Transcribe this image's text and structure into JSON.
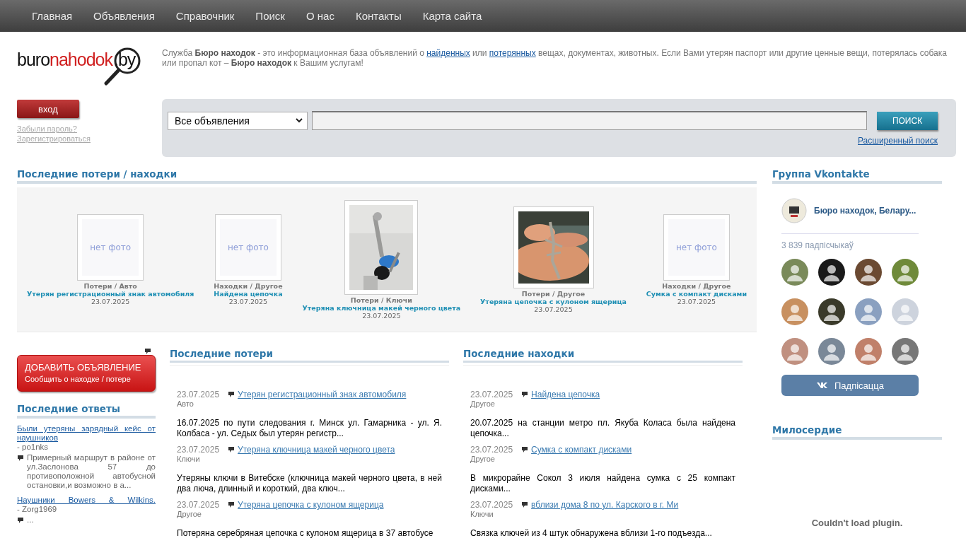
{
  "nav": [
    {
      "label": "Главная"
    },
    {
      "label": "Объявления"
    },
    {
      "label": "Справочник"
    },
    {
      "label": "Поиск"
    },
    {
      "label": "О нас"
    },
    {
      "label": "Контакты"
    },
    {
      "label": "Карта сайта"
    }
  ],
  "logo": {
    "part1": "buro",
    "part2": "nahodok",
    "part3": ".by"
  },
  "intro": [
    {
      "kind": "text",
      "text": "Служба **Бюро находок** - это информационная база объявлений о "
    },
    {
      "kind": "link",
      "text": "найденных"
    },
    {
      "kind": "text",
      "text": " или "
    },
    {
      "kind": "link",
      "text": "потерянных"
    },
    {
      "kind": "text",
      "text": " вещах, документах, животных. Если Вами утерян паспорт или другие ценные вещи, потерялась собака или пропал кот – **Бюро находок** к Вашим услугам!"
    }
  ],
  "login": {
    "button": "вход",
    "forgot": "Забыли пароль?",
    "register": "Зарегистрироваться"
  },
  "search": {
    "category": "Все объявления",
    "button": "ПОИСК",
    "advanced": "Расширенный поиск"
  },
  "gallery": {
    "title": "Последние потери / находки",
    "items": [
      {
        "no_photo_label": "нет фото",
        "category": "Потери / Авто",
        "title": "Утерян регистрационный знак автомобиля",
        "date": "23.07.2025"
      },
      {
        "no_photo_label": "нет фото",
        "category": "Находки / Другое",
        "title": "Найдена цепочка",
        "date": "23.07.2025"
      },
      {
        "kind": "picture",
        "category": "Потери / Ключи",
        "title": "Утеряна ключница макей черного цвета",
        "date": "23.07.2025"
      },
      {
        "kind": "picture",
        "category": "Потери / Другое",
        "title": "Утеряна цепочка с кулоном ящерица",
        "date": "23.07.2025"
      },
      {
        "no_photo_label": "нет фото",
        "category": "Находки / Другое",
        "title": "Сумка с компакт дисками",
        "date": "23.07.2025"
      }
    ]
  },
  "add_button": {
    "title": "ДОБАВИТЬ ОБЪЯВЛЕНИЕ",
    "subtitle": "Сообщить о находке / потере"
  },
  "answers": {
    "title": "Последние ответы",
    "items": [
      {
        "link": "Были утеряны зарядный кейс от наушников",
        "author": " - po1nks",
        "comment": "Примерный маршрут в районе от ул.Заслонова 57 до противоположной автобусной остановки,и возможно в а..."
      },
      {
        "link": "Наушники Bowers & Wilkins.",
        "author": " - Zorg1969",
        "comment": "..."
      }
    ]
  },
  "losses": {
    "title": "Последние потери",
    "items": [
      {
        "date": "23.07.2025",
        "title": "Утерян регистрационный знак автомобиля",
        "category": "Авто",
        "text": "16.07.2025 по пути следования г. Минск ул. Гамарника - ул. Я. Колбаса - ул. Седых был утерян регистр..."
      },
      {
        "date": "23.07.2025",
        "title": "Утеряна ключница макей черного цвета",
        "category": "Ключи",
        "text": "Утеряны ключи в Витебске (ключница макей черного цвета, в ней два люча, длинный и короткий, два ключ..."
      },
      {
        "date": "23.07.2025",
        "title": "Утеряна цепочка с кулоном ящерица",
        "category": "Другое",
        "text": "Потеряна серебряная цепочка с кулоном ящерица в 37 автобусе"
      }
    ]
  },
  "finds": {
    "title": "Последние находки",
    "items": [
      {
        "date": "23.07.2025",
        "title": "Найдена цепочка",
        "category": "Другое",
        "text": "20.07.2025 на станции метро пл. Якуба Коласа была найдена цепочка..."
      },
      {
        "date": "23.07.2025",
        "title": "Сумка с компакт дисками",
        "category": "Другое",
        "text": "В микрорайне Сокол 3 июля найдена сумка с 25 компакт дисками..."
      },
      {
        "date": "23.07.2025",
        "title": "вблизи дома 8 по ул. Карского в г. Ми",
        "category": "Ключи",
        "text": "Связка ключей из 4 штук обнаружена вблизи 1-го подъезда..."
      }
    ]
  },
  "vk": {
    "title": "Группа Vkontakte",
    "group_name": "Бюро находок, Белару...",
    "count": "3 839",
    "count_label": "падпісчыкаў",
    "button": "Падпісацца",
    "members": [
      {
        "color": "#7a8a5a"
      },
      {
        "color": "#1a1a1a"
      },
      {
        "color": "#6b4a32"
      },
      {
        "color": "#6f8a3a"
      },
      {
        "color": "#c89060"
      },
      {
        "color": "#3a3a2a"
      },
      {
        "color": "#8aa0c0"
      },
      {
        "color": "#cdd3dd"
      },
      {
        "color": "#c09080"
      },
      {
        "color": "#7a8898"
      },
      {
        "color": "#c0806a"
      },
      {
        "color": "#777777"
      }
    ]
  },
  "mercy": {
    "title": "Милосердие",
    "message": "Couldn't load plugin."
  }
}
